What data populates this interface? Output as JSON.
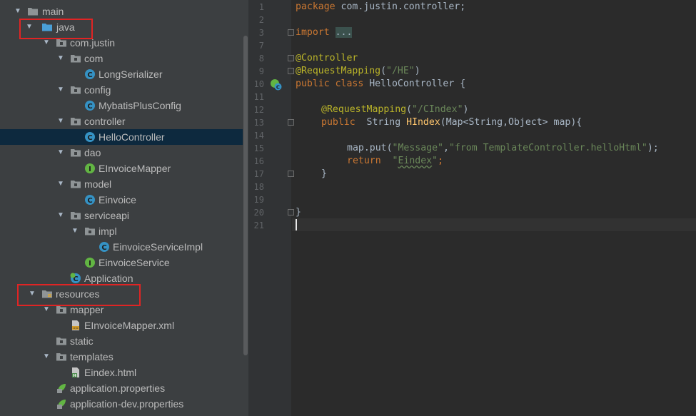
{
  "project_tree": {
    "items": [
      {
        "label": "main",
        "expanded": true,
        "icon": "folder-icon"
      },
      {
        "label": "java",
        "expanded": true,
        "icon": "source-folder-icon",
        "highlighted": true
      },
      {
        "label": "com.justin",
        "expanded": true,
        "icon": "package-icon"
      },
      {
        "label": "com",
        "expanded": true,
        "icon": "package-icon"
      },
      {
        "label": "LongSerializer",
        "icon": "class-icon"
      },
      {
        "label": "config",
        "expanded": true,
        "icon": "package-icon"
      },
      {
        "label": "MybatisPlusConfig",
        "icon": "class-icon"
      },
      {
        "label": "controller",
        "expanded": true,
        "icon": "package-icon"
      },
      {
        "label": "HelloController",
        "icon": "class-icon",
        "selected": true
      },
      {
        "label": "dao",
        "expanded": true,
        "icon": "package-icon"
      },
      {
        "label": "EInvoiceMapper",
        "icon": "interface-icon"
      },
      {
        "label": "model",
        "expanded": true,
        "icon": "package-icon"
      },
      {
        "label": "Einvoice",
        "icon": "class-icon"
      },
      {
        "label": "serviceapi",
        "expanded": true,
        "icon": "package-icon"
      },
      {
        "label": "impl",
        "expanded": true,
        "icon": "package-icon"
      },
      {
        "label": "EinvoiceServiceImpl",
        "icon": "class-icon"
      },
      {
        "label": "EinvoiceService",
        "icon": "interface-icon"
      },
      {
        "label": "Application",
        "icon": "spring-boot-class-icon"
      },
      {
        "label": "resources",
        "expanded": true,
        "icon": "resources-folder-icon",
        "highlighted": true
      },
      {
        "label": "mapper",
        "expanded": true,
        "icon": "folder-icon"
      },
      {
        "label": "EInvoiceMapper.xml",
        "icon": "xml-file-icon"
      },
      {
        "label": "static",
        "icon": "folder-icon"
      },
      {
        "label": "templates",
        "expanded": true,
        "icon": "folder-icon"
      },
      {
        "label": "Eindex.html",
        "icon": "html-file-icon"
      },
      {
        "label": "application.properties",
        "icon": "properties-file-icon"
      },
      {
        "label": "application-dev.properties",
        "icon": "properties-file-icon"
      }
    ]
  },
  "editor": {
    "line_numbers": [
      "1",
      "2",
      "3",
      "7",
      "8",
      "9",
      "10",
      "11",
      "12",
      "13",
      "14",
      "15",
      "16",
      "17",
      "18",
      "19",
      "20",
      "21"
    ],
    "code": {
      "package_kw": "package",
      "package_name": " com.justin.controller;",
      "import_kw": "import",
      "import_fold": "...",
      "controller_ann": "@Controller",
      "request_mapping_ann": "@RequestMapping",
      "request_mapping_open": "(",
      "request_mapping_val": "\"/HE\"",
      "request_mapping_close": ")",
      "class_kw": "public class",
      "class_name": " HelloController {",
      "method_ann": "@RequestMapping",
      "method_ann_open": "(",
      "method_ann_val": "\"/CIndex\"",
      "method_ann_close": ")",
      "method_kw": "public",
      "method_type": "  String ",
      "method_name": "HIndex",
      "method_params": "(Map<String,Object> map){",
      "put_call": "map.put(",
      "put_key": "\"Message\"",
      "put_comma": ",",
      "put_val": "\"from TemplateController.helloHtml\"",
      "put_end": ");",
      "return_kw": "return",
      "return_space": "  ",
      "return_q1": "\"",
      "return_val": "Eindex",
      "return_q2": "\"",
      "return_end": ";",
      "method_close": "}",
      "class_close": "}"
    }
  },
  "colors": {
    "tree_bg": "#3c3f41",
    "editor_bg": "#2b2b2b",
    "selection": "#0d293e",
    "highlight_box": "#e02424",
    "keyword": "#cc7832",
    "annotation": "#bbb529",
    "string": "#6a8759",
    "method": "#ffc66d"
  }
}
